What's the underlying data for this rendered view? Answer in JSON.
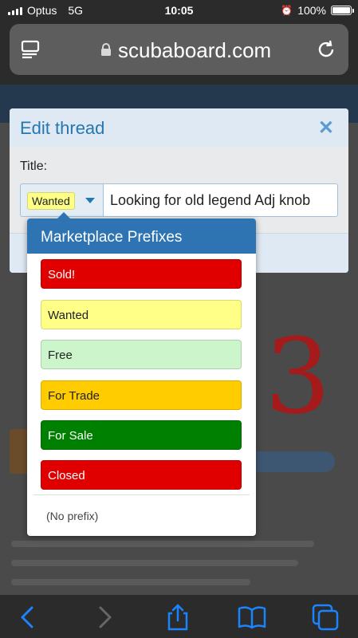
{
  "status_bar": {
    "carrier": "Optus",
    "network": "5G",
    "time": "10:05",
    "battery": "100%"
  },
  "browser": {
    "domain": "scubaboard.com"
  },
  "dialog": {
    "title": "Edit thread",
    "title_label": "Title:",
    "selected_prefix": "Wanted",
    "title_value": "Looking for old legend Adj knob"
  },
  "prefix_menu": {
    "heading": "Marketplace Prefixes",
    "options": [
      {
        "label": "Sold!",
        "bg": "#e00000",
        "fg": "#ffffff"
      },
      {
        "label": "Wanted",
        "bg": "#ffff88",
        "fg": "#222222"
      },
      {
        "label": "Free",
        "bg": "#ccf5cc",
        "fg": "#222222"
      },
      {
        "label": "For Trade",
        "bg": "#ffcc00",
        "fg": "#222222"
      },
      {
        "label": "For Sale",
        "bg": "#008000",
        "fg": "#ffffff"
      },
      {
        "label": "Closed",
        "bg": "#e00000",
        "fg": "#ffffff"
      }
    ],
    "no_prefix": "(No prefix)"
  },
  "colors": {
    "accent": "#2e74b3",
    "ios_blue": "#1a84ff"
  }
}
